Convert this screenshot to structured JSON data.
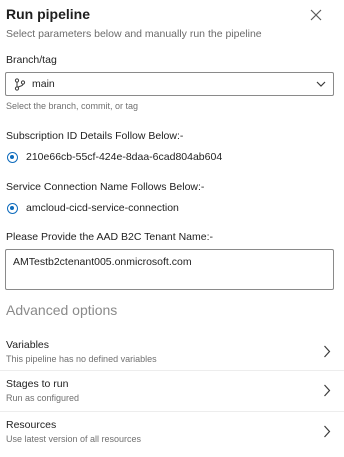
{
  "panel": {
    "title": "Run pipeline",
    "subtitle": "Select parameters below and manually run the pipeline"
  },
  "branch": {
    "label": "Branch/tag",
    "value": "main",
    "hint": "Select the branch, commit, or tag"
  },
  "subscription": {
    "label": "Subscription ID Details Follow Below:-",
    "options": [
      {
        "value": "210e66cb-55cf-424e-8daa-6cad804ab604",
        "selected": true
      }
    ]
  },
  "service_connection": {
    "label": "Service Connection Name Follows Below:-",
    "options": [
      {
        "value": "amcloud-cicd-service-connection",
        "selected": true
      }
    ]
  },
  "tenant": {
    "label": "Please Provide the AAD B2C Tenant Name:-",
    "value": "AMTestb2ctenant005.onmicrosoft.com"
  },
  "advanced": {
    "title": "Advanced options",
    "items": [
      {
        "title": "Variables",
        "subtitle": "This pipeline has no defined variables"
      },
      {
        "title": "Stages to run",
        "subtitle": "Run as configured"
      },
      {
        "title": "Resources",
        "subtitle": "Use latest version of all resources"
      }
    ]
  },
  "icons": {
    "close": "close-icon",
    "branch": "branch-icon",
    "dropdown": "chevron-down-icon",
    "row_chevron": "chevron-right-icon"
  },
  "colors": {
    "accent": "#0f6cbd",
    "muted_text": "#707070",
    "border": "#8a8a8a"
  }
}
